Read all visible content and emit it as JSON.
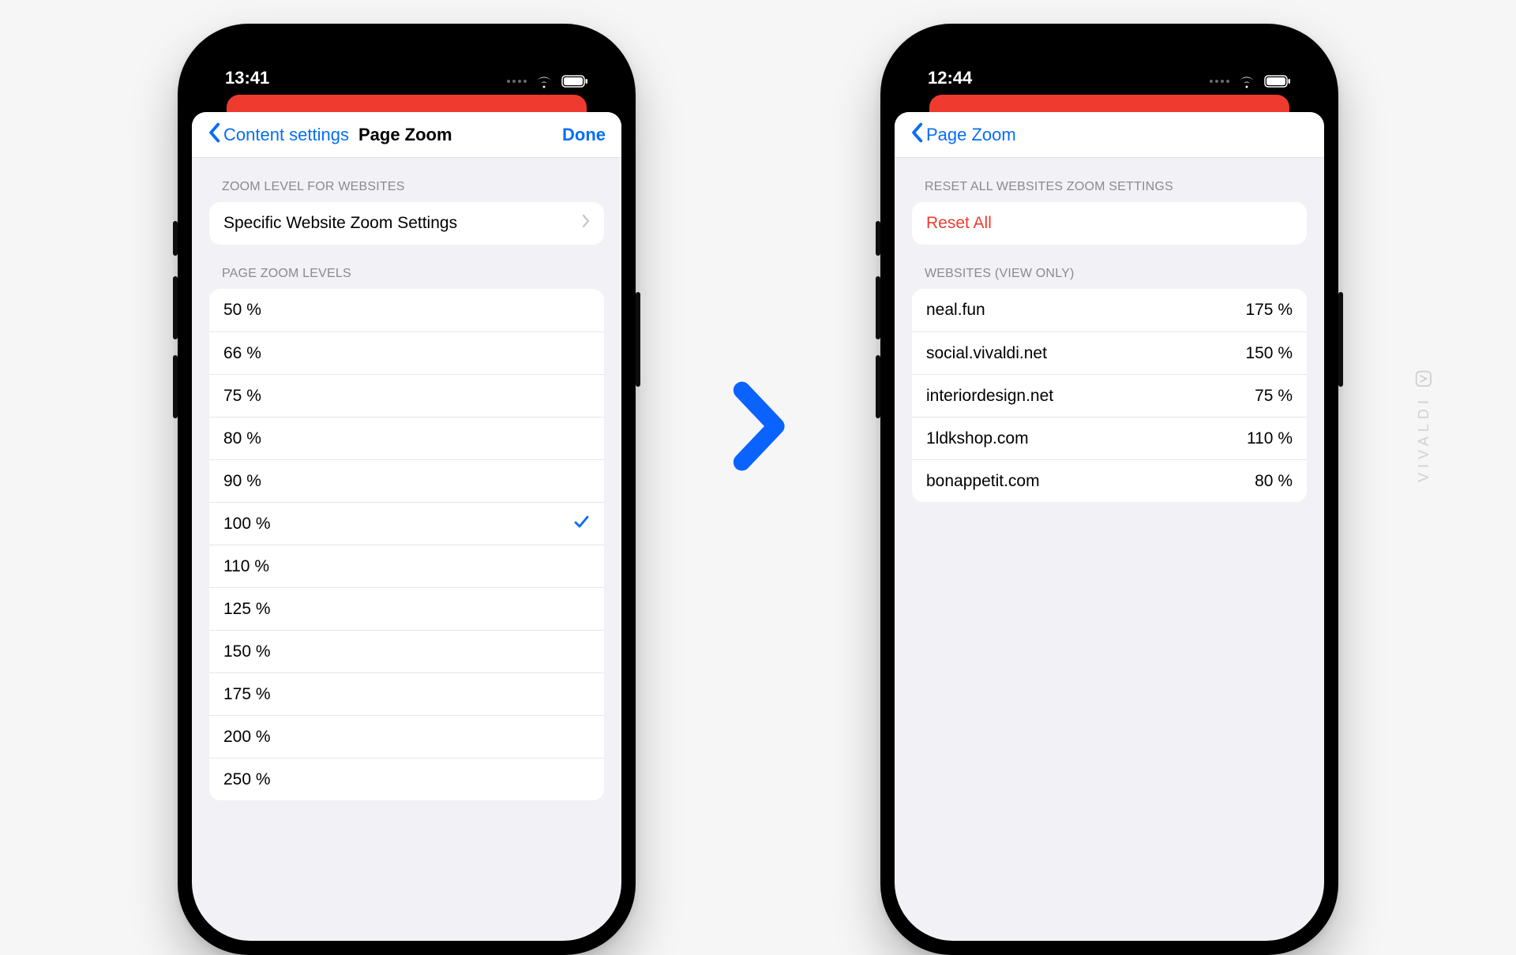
{
  "brand": "VIVALDI",
  "phone_left": {
    "status_time": "13:41",
    "nav_back_label": "Content settings",
    "nav_title": "Page Zoom",
    "nav_done": "Done",
    "section1_header": "ZOOM LEVEL FOR WEBSITES",
    "section1_link": "Specific Website Zoom Settings",
    "section2_header": "PAGE ZOOM LEVELS",
    "zoom_levels": [
      {
        "label": "50 %",
        "selected": false
      },
      {
        "label": "66 %",
        "selected": false
      },
      {
        "label": "75 %",
        "selected": false
      },
      {
        "label": "80 %",
        "selected": false
      },
      {
        "label": "90 %",
        "selected": false
      },
      {
        "label": "100 %",
        "selected": true
      },
      {
        "label": "110 %",
        "selected": false
      },
      {
        "label": "125 %",
        "selected": false
      },
      {
        "label": "150 %",
        "selected": false
      },
      {
        "label": "175 %",
        "selected": false
      },
      {
        "label": "200 %",
        "selected": false
      },
      {
        "label": "250 %",
        "selected": false
      }
    ]
  },
  "phone_right": {
    "status_time": "12:44",
    "nav_back_label": "Page Zoom",
    "section1_header": "RESET ALL WEBSITES ZOOM SETTINGS",
    "reset_label": "Reset All",
    "section2_header": "WEBSITES (VIEW ONLY)",
    "websites": [
      {
        "site": "neal.fun",
        "value": "175 %"
      },
      {
        "site": "social.vivaldi.net",
        "value": "150 %"
      },
      {
        "site": "interiordesign.net",
        "value": "75 %"
      },
      {
        "site": "1ldkshop.com",
        "value": "110 %"
      },
      {
        "site": "bonappetit.com",
        "value": "80 %"
      }
    ]
  }
}
